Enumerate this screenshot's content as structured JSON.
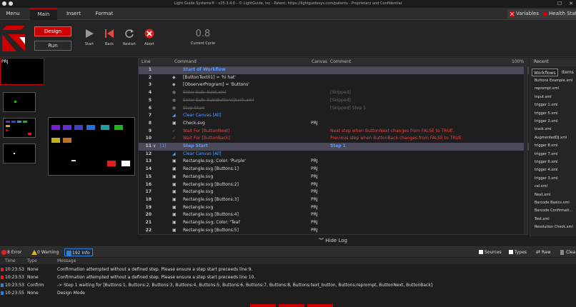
{
  "window": {
    "title": "Light Guide Systems® - v25.3.4.0 - © LightGuide, Inc - Patent: https://lightguidesys.com/patents - Proprietary and Confidential",
    "close": "✕"
  },
  "tabs": [
    {
      "label": "Menu"
    },
    {
      "label": "Main"
    },
    {
      "label": "Insert"
    },
    {
      "label": "Format"
    }
  ],
  "top_buttons": {
    "variables": "Variables",
    "health": "Health Status"
  },
  "ribbon": {
    "design": "Design",
    "run": "Run",
    "start": "Start",
    "back": "Back",
    "restart": "Restart",
    "abort": "Abort",
    "cycle_value": "0.8",
    "cycle_label": "Current Cycle"
  },
  "left_pane": {
    "active_label": "PRJ"
  },
  "editor": {
    "columns": {
      "line": "Line",
      "command": "Command",
      "canvas": "Canvas",
      "comment": "Comment",
      "zoom": "100%"
    },
    "rows": [
      {
        "n": "1",
        "cmd": "Start of Workflow",
        "canvas": "",
        "comment": ""
      },
      {
        "n": "2",
        "cmd": "[ButtonText01] = 'hi hat'",
        "canvas": "",
        "comment": ""
      },
      {
        "n": "3",
        "cmd": "[ObserverProgram] = 'Buttons'",
        "canvas": "",
        "comment": ""
      },
      {
        "n": "4",
        "cmd": "Enter Sub: Next.xml",
        "canvas": "",
        "comment": "[Skipped]"
      },
      {
        "n": "5",
        "cmd": "Enter Sub: Sub\\Buttons\\back.xml",
        "canvas": "",
        "comment": "[Skipped]"
      },
      {
        "n": "6",
        "cmd": "Step Start",
        "canvas": "",
        "comment": "[Skipped] Step 1"
      },
      {
        "n": "7",
        "cmd": "Clear Canvas [All]",
        "canvas": "",
        "comment": ""
      },
      {
        "n": "8",
        "cmd": "Check.svg",
        "canvas": "PRJ",
        "comment": ""
      },
      {
        "n": "9",
        "cmd": "Wait For [ButtonNext]",
        "canvas": "",
        "comment": "Next step when ButtonNext changes from FALSE to TRUE."
      },
      {
        "n": "10",
        "cmd": "Wait For [ButtonBack]",
        "canvas": "",
        "comment": "Previous step when ButtonBack changes from FALSE to TRUE."
      },
      {
        "n": "11",
        "fold": "∨",
        "tag": "[1]",
        "cmd": "Step Start",
        "canvas": "",
        "comment": "Step 1"
      },
      {
        "n": "12",
        "cmd": "Clear Canvas [All]",
        "canvas": "",
        "comment": ""
      },
      {
        "n": "13",
        "cmd": "Rectangle.svg; Color: 'Purple'",
        "canvas": "PRJ",
        "comment": ""
      },
      {
        "n": "14",
        "cmd": "Rectangle.svg [Buttons:1]",
        "canvas": "PRJ",
        "comment": ""
      },
      {
        "n": "15",
        "cmd": "Rectangle.svg",
        "canvas": "PRJ",
        "comment": ""
      },
      {
        "n": "16",
        "cmd": "Rectangle.svg [Buttons:2]",
        "canvas": "PRJ",
        "comment": ""
      },
      {
        "n": "17",
        "cmd": "Rectangle.svg",
        "canvas": "PRJ",
        "comment": ""
      },
      {
        "n": "18",
        "cmd": "Rectangle.svg [Buttons:3]",
        "canvas": "PRJ",
        "comment": ""
      },
      {
        "n": "19",
        "cmd": "Rectangle.svg",
        "canvas": "PRJ",
        "comment": ""
      },
      {
        "n": "20",
        "cmd": "Rectangle.svg [Buttons:4]",
        "canvas": "PRJ",
        "comment": ""
      },
      {
        "n": "21",
        "cmd": "Rectangle.svg; Color: 'Teal'",
        "canvas": "PRJ",
        "comment": ""
      },
      {
        "n": "22",
        "cmd": "Rectangle.svg [Buttons:5]",
        "canvas": "PRJ",
        "comment": ""
      }
    ]
  },
  "hide_log": "Hide Log",
  "right_pane": {
    "recent": "Recent",
    "tabs": [
      "Workflows",
      "Items"
    ],
    "files": [
      "Buttons Example.xml",
      "reprompt.xml",
      "input.xml",
      "trigger 1.xml",
      "trigger 5.xml",
      "trigger 2.xml",
      "track.xml",
      "AugmentedDJ.xml",
      "trigger 8.xml",
      "trigger 7.xml",
      "trigger 6.xml",
      "trigger 4.xml",
      "trigger 3.xml",
      "cal.xml",
      "Next.xml",
      "Barcode Basics.xml",
      "Barcode Confirmati...",
      "Test.xml",
      "Resolution Check.xml"
    ]
  },
  "log_toolbar": {
    "errors": "8 Error",
    "warnings": "0 Warning",
    "info": "192 Info",
    "sources": "Sources",
    "types": "Types",
    "raw": "Raw",
    "clear": "Clea"
  },
  "log": {
    "columns": {
      "time": "Time",
      "type": "Type",
      "message": "Message"
    },
    "rows": [
      {
        "time": "10:23:53",
        "type": "None",
        "message": "Confirmation attempted without a defined step. Please ensure a step start preceeds line 9.",
        "level": "error"
      },
      {
        "time": "10:23:53",
        "type": "None",
        "message": "Confirmation attempted without a defined step. Please ensure a step start preceeds line 10.",
        "level": "error"
      },
      {
        "time": "10:23:53",
        "type": "Confirm",
        "message": "-> Step 1 waiting for [Buttons:1, Buttons:2, Buttons:3, Buttons:4, Buttons:5, Buttons:6, Buttons:7, Buttons:8, Buttons:text_button, Buttons:reprompt, ButtonNext, ButtonBack]",
        "level": "info"
      },
      {
        "time": "10:23:55",
        "type": "None",
        "message": "Design Mode",
        "level": "info"
      }
    ]
  },
  "colors": {
    "accent": "#cc0000",
    "error": "#e04848",
    "info_blue": "#2f7fd8",
    "header_row": "#4a4a5a"
  }
}
